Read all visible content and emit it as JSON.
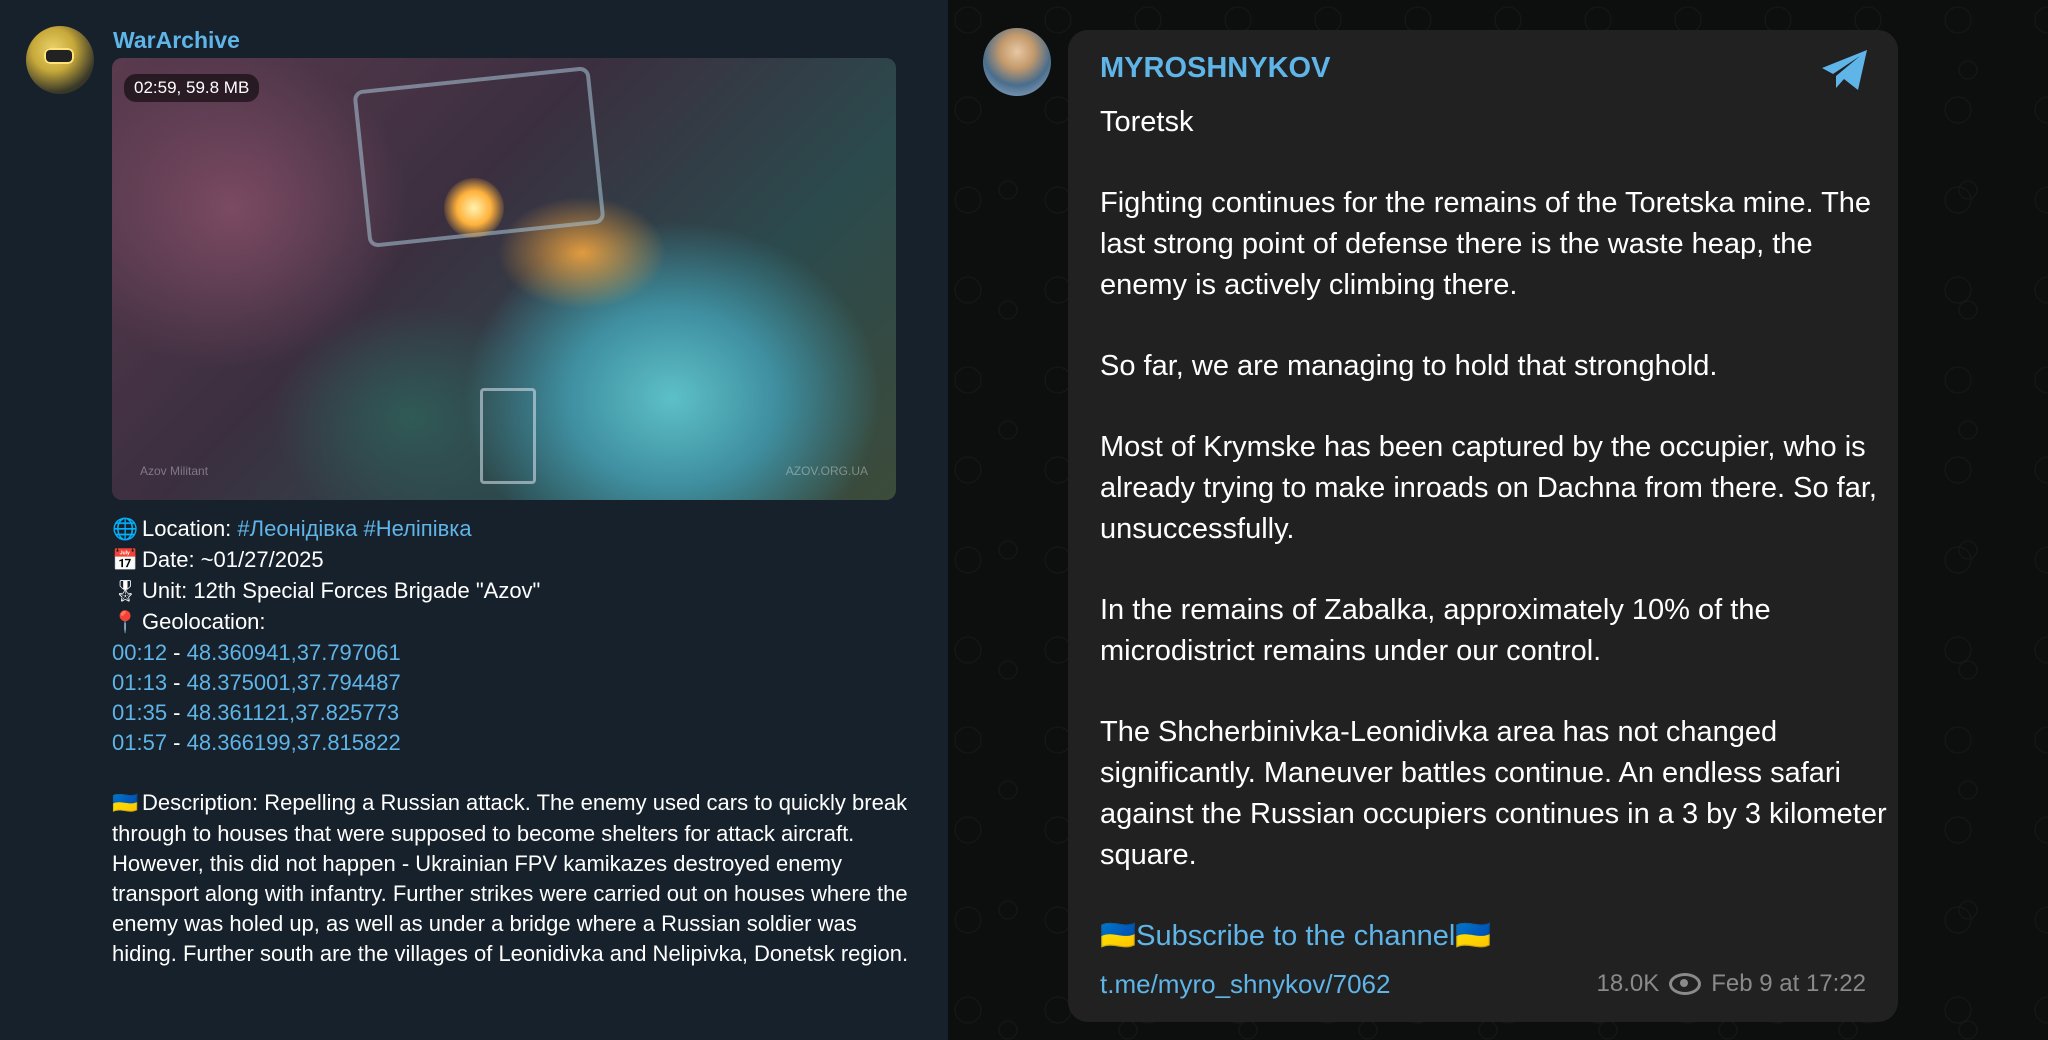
{
  "colors": {
    "accent": "#5fb4e8",
    "left_bg": "#17212b",
    "right_card_bg": "#212121",
    "text": "#ffffff",
    "meta": "#8a8a8a"
  },
  "left_post": {
    "channel_name": "WarArchive",
    "video": {
      "duration_size": "02:59, 59.8 MB",
      "watermark_left": "Azov Militant",
      "watermark_right": "AZOV.ORG.UA"
    },
    "lines": [
      {
        "icon": "globe-icon",
        "emoji": "🌐",
        "label": "Location: ",
        "links": "#Леонідівка #Неліпівка"
      },
      {
        "icon": "calendar-icon",
        "emoji": "📅",
        "label": "Date: ~01/27/2025"
      },
      {
        "icon": "medal-icon",
        "emoji": "🎖",
        "label": "Unit: 12th Special Forces Brigade \"Azov\""
      },
      {
        "icon": "pin-icon",
        "emoji": "📍",
        "label": "Geolocation:"
      }
    ],
    "geo": [
      {
        "time": "00:12",
        "sep": " - ",
        "coords": "48.360941,37.797061"
      },
      {
        "time": "01:13",
        "sep": " - ",
        "coords": "48.375001,37.794487"
      },
      {
        "time": "01:35",
        "sep": " - ",
        "coords": "48.361121,37.825773"
      },
      {
        "time": "01:57",
        "sep": " - ",
        "coords": "48.366199,37.815822"
      }
    ],
    "description": {
      "flag": "🇺🇦",
      "text": "Description: Repelling a Russian attack. The enemy used cars to quickly break through to houses that were supposed to become shelters for attack aircraft. However, this did not happen - Ukrainian FPV kamikazes destroyed enemy transport along with infantry. Further strikes were carried out on houses where the enemy was holed up, as well as under a bridge where a Russian soldier was hiding. Further south are the villages of Leonidivka and Nelipivka, Donetsk region."
    }
  },
  "right_post": {
    "channel_name": "MYROSHNYKOV",
    "paragraphs": [
      "Toretsk",
      "Fighting continues for the remains of the Toretska mine. The last strong point of defense there is the waste heap, the enemy is actively climbing there.",
      "So far, we are managing to hold that stronghold.",
      "Most of Krymske has been captured by the occupier, who is already trying to make inroads on Dachna from there. So far, unsuccessfully.",
      "In the remains of Zabalka, approximately 10% of the microdistrict remains under our control.",
      "The Shcherbinivka-Leonidivka area has not changed significantly. Maneuver battles continue. An endless safari against the Russian occupiers continues in a 3 by 3 kilometer square."
    ],
    "subscribe": "🇺🇦Subscribe to the channel🇺🇦",
    "link": "t.me/myro_shnykov/7062",
    "views": "18.0K",
    "date": "Feb 9 at 17:22"
  }
}
